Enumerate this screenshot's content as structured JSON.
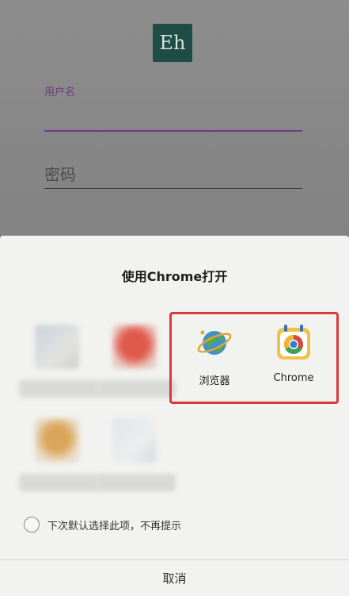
{
  "login": {
    "logo_text": "Eh",
    "username_label": "用户名",
    "password_placeholder": "密码"
  },
  "sheet": {
    "title": "使用Chrome打开",
    "apps": [
      {
        "label": "浏览器",
        "icon": "browser-globe-icon"
      },
      {
        "label": "Chrome",
        "icon": "chrome-icon"
      }
    ],
    "default_option": "下次默认选择此项，不再提示",
    "cancel_label": "取消"
  },
  "colors": {
    "accent": "#733a87",
    "highlight": "#d83a3a",
    "logo_bg": "#1d4d44"
  }
}
